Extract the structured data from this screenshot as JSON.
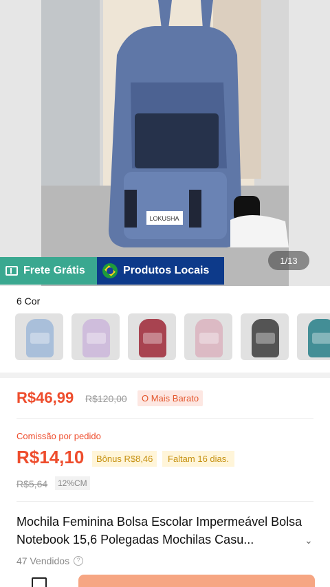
{
  "hero": {
    "counter": "1/13",
    "badges": {
      "frete": "Frete Grátis",
      "local": "Produtos Locais"
    },
    "icons": {
      "frete": "ticket-icon",
      "local": "brazil-flag-icon"
    }
  },
  "variants": {
    "title": "6 Cor",
    "swatches": [
      {
        "name": "light-blue",
        "color": "#9eb7d6"
      },
      {
        "name": "light-purple",
        "color": "#c9b5d8"
      },
      {
        "name": "burgundy",
        "color": "#9d2a39"
      },
      {
        "name": "pink",
        "color": "#d8b1bd"
      },
      {
        "name": "black",
        "color": "#3d3d3d"
      },
      {
        "name": "teal",
        "color": "#2a7f88"
      }
    ]
  },
  "pricing": {
    "price": "R$46,99",
    "old_price": "R$120,00",
    "tag": "O Mais Barato"
  },
  "commission": {
    "label": "Comissão por pedido",
    "value": "R$14,10",
    "bonus": "Bônus R$8,46",
    "days_left": "Faltam 16 dias.",
    "old_value": "R$5,64",
    "rate": "12%CM"
  },
  "product": {
    "title": "Mochila Feminina Bolsa Escolar Impermeável Bolsa Notebook 15,6 Polegadas Mochilas Casu...",
    "sold": "47 Vendidos",
    "question_icon": "question-icon"
  },
  "colors": {
    "accent": "#ee4d2d",
    "frete": "#3aa890",
    "local": "#0d3a8a",
    "cta": "#f6a683"
  }
}
